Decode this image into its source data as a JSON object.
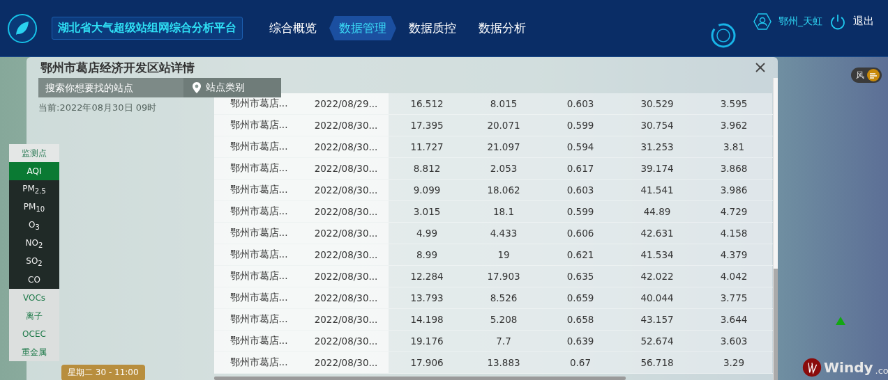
{
  "header": {
    "title": "湖北省大气超级站组网综合分析平台",
    "nav": [
      {
        "label": "综合概览",
        "selected": false
      },
      {
        "label": "数据管理",
        "selected": true
      },
      {
        "label": "数据质控",
        "selected": false
      },
      {
        "label": "数据分析",
        "selected": false
      }
    ],
    "user": "鄂州_天虹",
    "logout": "退出"
  },
  "map_panel": {
    "search": {
      "placeholder": "搜索你想要找的站点"
    },
    "category_button": "站点类别",
    "current_time": "当前:2022年08月30日 09时",
    "legend": [
      {
        "label": "监测点",
        "kind": "header",
        "selected": false
      },
      {
        "label": "AQI",
        "kind": "standard",
        "selected": true
      },
      {
        "label": "PM$_{2.5}$",
        "kind": "standard",
        "selected": false
      },
      {
        "label": "PM$_{10}$",
        "kind": "standard",
        "selected": false
      },
      {
        "label": "O$_{3}$",
        "kind": "standard",
        "selected": false
      },
      {
        "label": "NO$_{2}$",
        "kind": "standard",
        "selected": false
      },
      {
        "label": "SO$_{2}$",
        "kind": "standard",
        "selected": false
      },
      {
        "label": "CO",
        "kind": "standard",
        "selected": false
      },
      {
        "label": "VOCs",
        "kind": "other",
        "selected": false
      },
      {
        "label": "离子",
        "kind": "other",
        "selected": false
      },
      {
        "label": "OCEC",
        "kind": "other",
        "selected": false
      },
      {
        "label": "重金属",
        "kind": "other",
        "selected": false
      }
    ],
    "time_badge": "星期二 30 - 11:00",
    "wind_toggle": "风",
    "brand": "Windy",
    "brand_suffix": ".co"
  },
  "dialog": {
    "title": "鄂州市葛店经济开发区站详情",
    "table": {
      "rows": [
        [
          "鄂州市葛店...",
          "2022/08/29...",
          "16.512",
          "8.015",
          "0.603",
          "30.529",
          "3.595"
        ],
        [
          "鄂州市葛店...",
          "2022/08/30...",
          "17.395",
          "20.071",
          "0.599",
          "30.754",
          "3.962"
        ],
        [
          "鄂州市葛店...",
          "2022/08/30...",
          "11.727",
          "21.097",
          "0.594",
          "31.253",
          "3.81"
        ],
        [
          "鄂州市葛店...",
          "2022/08/30...",
          "8.812",
          "2.053",
          "0.617",
          "39.174",
          "3.868"
        ],
        [
          "鄂州市葛店...",
          "2022/08/30...",
          "9.099",
          "18.062",
          "0.603",
          "41.541",
          "3.986"
        ],
        [
          "鄂州市葛店...",
          "2022/08/30...",
          "3.015",
          "18.1",
          "0.599",
          "44.89",
          "4.729"
        ],
        [
          "鄂州市葛店...",
          "2022/08/30...",
          "4.99",
          "4.433",
          "0.606",
          "42.631",
          "4.158"
        ],
        [
          "鄂州市葛店...",
          "2022/08/30...",
          "8.99",
          "19",
          "0.621",
          "41.534",
          "4.379"
        ],
        [
          "鄂州市葛店...",
          "2022/08/30...",
          "12.284",
          "17.903",
          "0.635",
          "42.022",
          "4.042"
        ],
        [
          "鄂州市葛店...",
          "2022/08/30...",
          "13.793",
          "8.526",
          "0.659",
          "40.044",
          "3.775"
        ],
        [
          "鄂州市葛店...",
          "2022/08/30...",
          "14.198",
          "5.208",
          "0.658",
          "43.157",
          "3.644"
        ],
        [
          "鄂州市葛店...",
          "2022/08/30...",
          "19.176",
          "7.7",
          "0.639",
          "52.674",
          "3.603"
        ],
        [
          "鄂州市葛店...",
          "2022/08/30...",
          "17.906",
          "13.883",
          "0.67",
          "56.718",
          "3.29"
        ]
      ]
    }
  }
}
